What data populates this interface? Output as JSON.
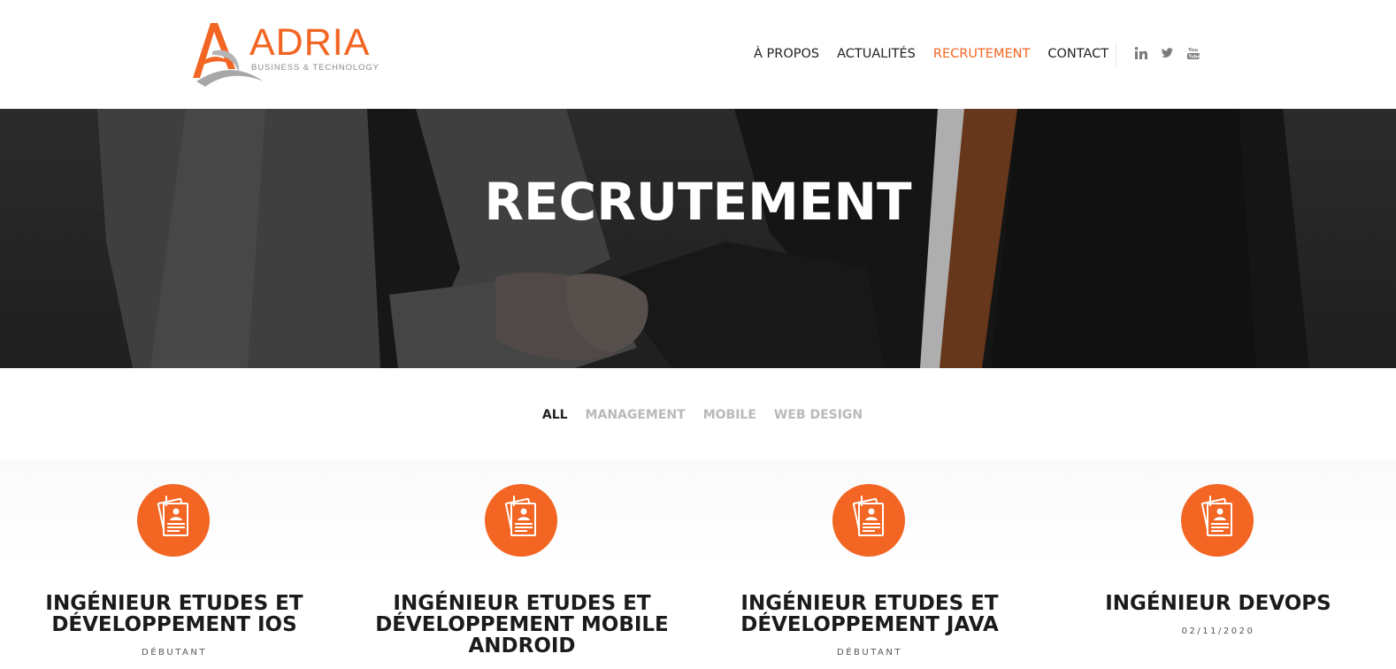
{
  "brand": {
    "name": "ADRIA",
    "tagline": "BUSINESS & TECHNOLOGY",
    "accent_color": "#f26522"
  },
  "nav": {
    "items": [
      {
        "label": "À PROPOS",
        "active": false
      },
      {
        "label": "ACTUALITÉS",
        "active": false
      },
      {
        "label": "RECRUTEMENT",
        "active": true
      },
      {
        "label": "CONTACT",
        "active": false
      }
    ],
    "social": [
      "linkedin-icon",
      "twitter-icon",
      "youtube-icon"
    ]
  },
  "hero": {
    "title": "RECRUTEMENT"
  },
  "filters": [
    {
      "label": "ALL",
      "active": true
    },
    {
      "label": "MANAGEMENT",
      "active": false
    },
    {
      "label": "MOBILE",
      "active": false
    },
    {
      "label": "WEB DESIGN",
      "active": false
    }
  ],
  "jobs": [
    {
      "title": "INGÉNIEUR ETUDES ET DÉVELOPPEMENT IOS",
      "meta": "DÉBUTANT",
      "icon": "resume-icon"
    },
    {
      "title": "INGÉNIEUR ETUDES ET DÉVELOPPEMENT MOBILE ANDROID",
      "meta": "",
      "icon": "resume-icon"
    },
    {
      "title": "INGÉNIEUR ETUDES ET DÉVELOPPEMENT JAVA",
      "meta": "DÉBUTANT",
      "icon": "resume-icon"
    },
    {
      "title": "INGÉNIEUR DEVOPS",
      "meta": "02/11/2020",
      "icon": "resume-icon"
    }
  ]
}
